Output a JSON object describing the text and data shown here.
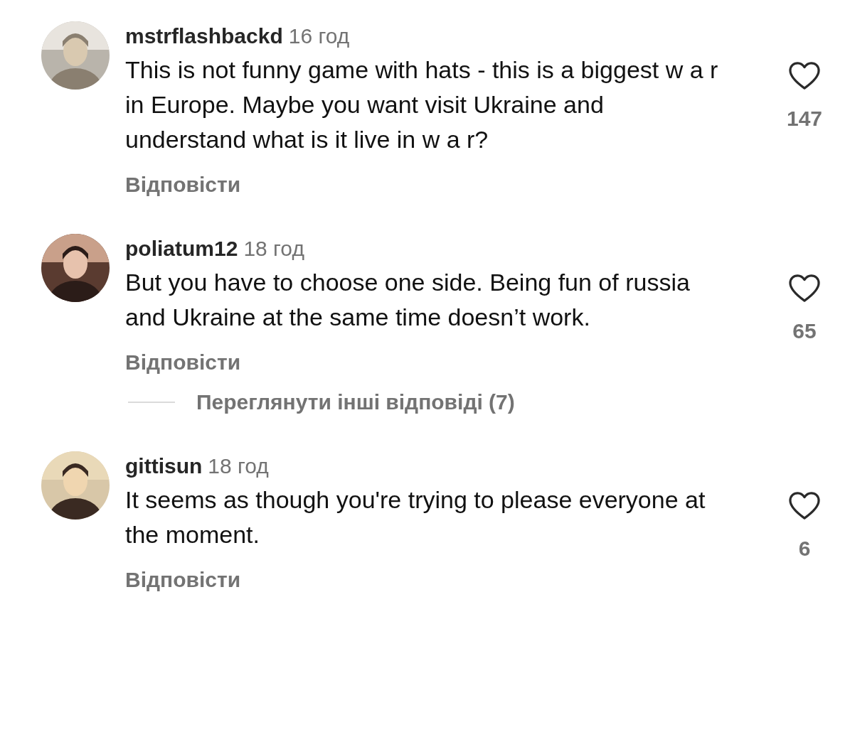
{
  "comments": [
    {
      "username": "mstrflashbackd",
      "time": "16 год",
      "text": "This is not funny game with hats - this is a biggest w a r in Europe. Maybe you want visit Ukraine and understand what is it live in w a r?",
      "likes": "147",
      "reply": "Відповісти"
    },
    {
      "username": "poliatum12",
      "time": "18 год",
      "text": "But you have to choose one side. Being fun of russia and Ukraine at the same time doesn’t work.",
      "likes": "65",
      "reply": "Відповісти",
      "more_replies": "Переглянути інші відповіді (7)"
    },
    {
      "username": "gittisun",
      "time": "18 год",
      "text": "It seems as though you're trying to please everyone at the moment.",
      "likes": "6",
      "reply": "Відповісти"
    }
  ]
}
